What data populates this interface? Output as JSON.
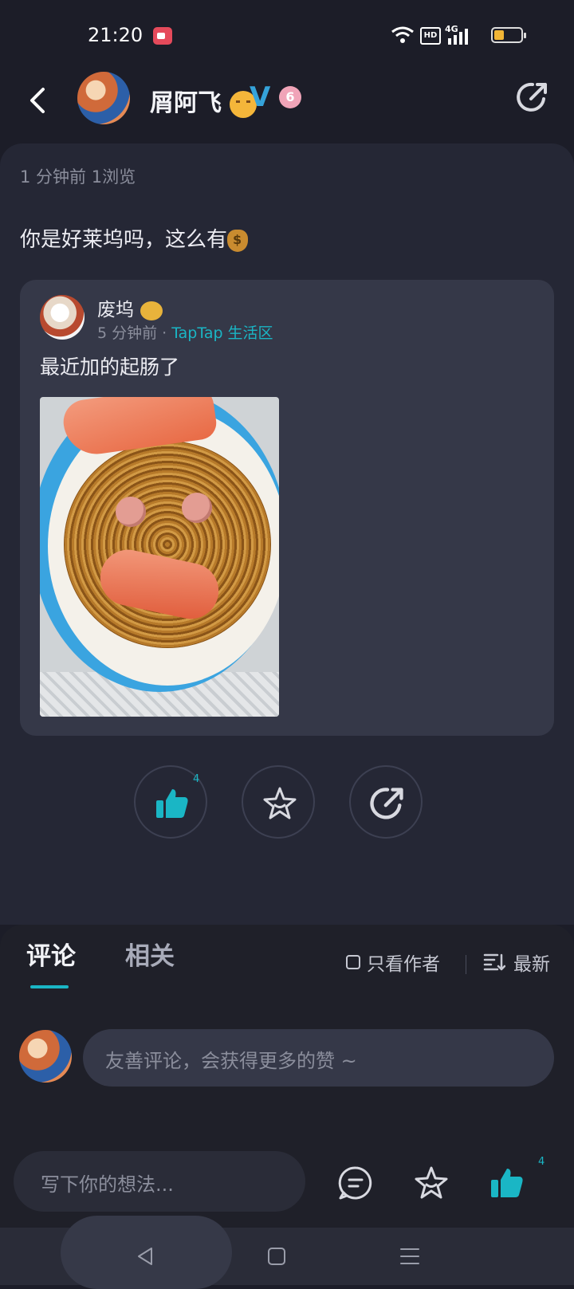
{
  "status_bar": {
    "time": "21:20",
    "network": "4G",
    "hd": "HD"
  },
  "header": {
    "username": "屑阿飞",
    "verified_mark": "V",
    "level": "6"
  },
  "post": {
    "meta": "1 分钟前   1浏览",
    "text": "你是好莱坞吗，这么有"
  },
  "quoted_post": {
    "author": "废坞",
    "time": "5 分钟前",
    "forum": "TapTap 生活区",
    "text": "最近加的起肠了"
  },
  "actions": {
    "like_count": "4"
  },
  "comments": {
    "tab_comments": "评论",
    "tab_related": "相关",
    "only_author": "只看作者",
    "sort": "最新",
    "input_placeholder": "友善评论，会获得更多的赞 ~"
  },
  "bottom_bar": {
    "write_placeholder": "写下你的想法...",
    "like_count": "4"
  },
  "colors": {
    "accent": "#1ab6c5",
    "background": "#1c1d28",
    "card": "#252735"
  }
}
